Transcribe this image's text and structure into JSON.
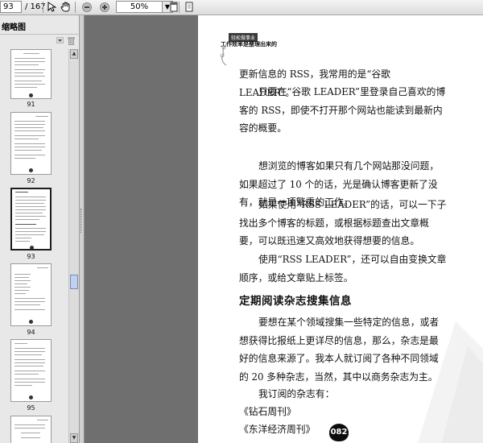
{
  "toolbar": {
    "page_current": "93",
    "page_total": "/ 167",
    "zoom_value": "50%",
    "zoom_dropdown_glyph": "▼"
  },
  "sidebar": {
    "title": "缩略图",
    "thumbnails": [
      {
        "label": "91",
        "selected": false
      },
      {
        "label": "92",
        "selected": false
      },
      {
        "label": "93",
        "selected": true
      },
      {
        "label": "94",
        "selected": false
      },
      {
        "label": "95",
        "selected": false
      }
    ],
    "scroll_up_glyph": "▲",
    "scroll_down_glyph": "▼"
  },
  "page": {
    "header_badge": "轻松做事业",
    "header_title": "工作效率是整理出来的",
    "paragraphs": [
      "更新信息的 RSS，我常用的是“谷歌 LEADER”。",
      "只要在“谷歌 LEADER”里登录自己喜欢的博客的 RSS，即使不打开那个网站也能读到最新内容的概要。",
      "想浏览的博客如果只有几个网站那没问题，如果超过了 10 个的话，光是确认博客更新了没有，就是一项繁重的工作。",
      "如果使用“RSS LEADER”的话，可以一下子找出多个博客的标题，或根据标题查出文章概要，可以既迅速又高效地获得想要的信息。",
      "使用“RSS LEADER”，还可以自由变换文章顺序，或给文章贴上标签。"
    ],
    "section_title": "定期阅读杂志搜集信息",
    "paragraphs2": [
      "要想在某个领域搜集一些特定的信息，或者想获得比报纸上更详尽的信息，那么，杂志是最好的信息来源了。我本人就订阅了各种不同领域的 20 多种杂志，当然，其中以商务杂志为主。",
      "我订阅的杂志有：",
      "《钻石周刊》",
      "《东洋经济周刊》"
    ],
    "page_number": "082"
  },
  "icons": [
    "cursor-icon",
    "hand-icon",
    "zoom-out-icon",
    "zoom-in-icon",
    "single-page-icon",
    "fit-page-icon",
    "sidebar-menu-icon",
    "trash-icon"
  ]
}
